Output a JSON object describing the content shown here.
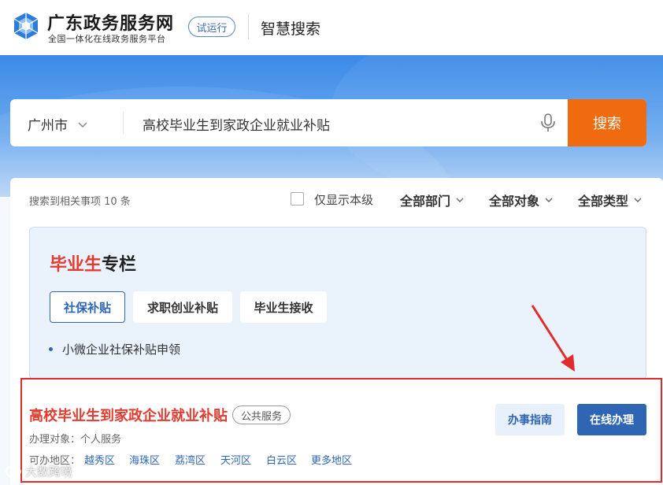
{
  "header": {
    "brand_title": "广东政务服务网",
    "brand_subtitle": "全国一体化在线政务服务平台",
    "trial_badge": "试运行",
    "section_title": "智慧搜索"
  },
  "search": {
    "city": "广州市",
    "query": "高校毕业生到家政企业就业补贴",
    "button_label": "搜索"
  },
  "filters": {
    "result_count": "搜索到相关事项 10 条",
    "only_this_level": "仅显示本级",
    "department": "全部部门",
    "audience": "全部对象",
    "type": "全部类型"
  },
  "graduate_column": {
    "title_highlight": "毕业生",
    "title_rest": "专栏",
    "tabs": [
      {
        "label": "社保补贴",
        "active": true
      },
      {
        "label": "求职创业补贴",
        "active": false
      },
      {
        "label": "毕业生接收",
        "active": false
      }
    ],
    "items": [
      "小微企业社保补贴申领"
    ]
  },
  "result_item": {
    "title": "高校毕业生到家政企业就业补贴",
    "badge": "公共服务",
    "target": "办理对象：个人服务",
    "area_label": "可办地区：",
    "areas": [
      "越秀区",
      "海珠区",
      "荔湾区",
      "天河区",
      "白云区",
      "更多地区"
    ],
    "guide_button": "办事指南",
    "online_button": "在线办理"
  },
  "watermark": "大数跨境",
  "colors": {
    "accent_blue": "#2f66b3",
    "search_orange": "#f06a10",
    "highlight_red": "#e23b2f",
    "annotation_red": "#e22b2b"
  }
}
